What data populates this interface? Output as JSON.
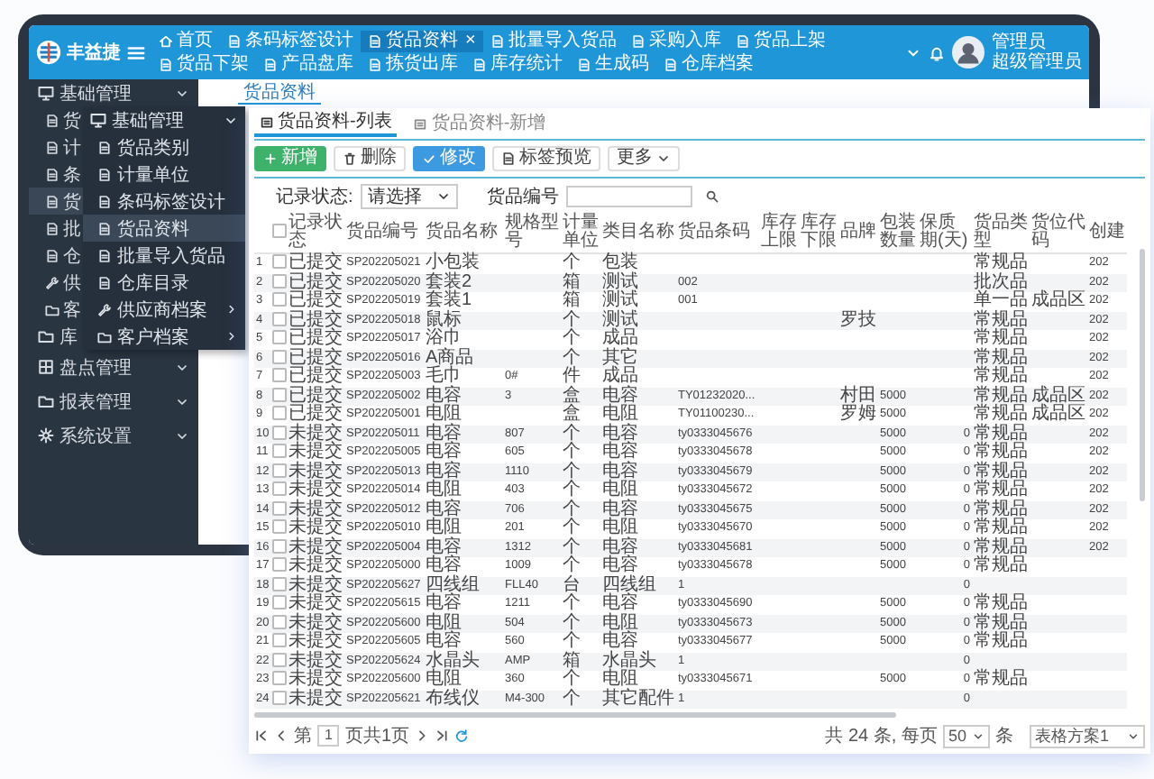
{
  "app": {
    "logo_text": "丰益捷",
    "user_name": "管理员",
    "user_role": "超级管理员"
  },
  "top_tabs": [
    {
      "label": "首页",
      "kind": "home",
      "selected": false
    },
    {
      "label": "条码标签设计",
      "kind": "page",
      "selected": false
    },
    {
      "label": "货品资料",
      "kind": "page",
      "selected": true,
      "close": "×"
    },
    {
      "label": "批量导入货品",
      "kind": "page",
      "selected": false
    },
    {
      "label": "采购入库",
      "kind": "page",
      "selected": false
    },
    {
      "label": "货品上架",
      "kind": "page",
      "selected": false
    },
    {
      "label": "货品下架",
      "kind": "page",
      "selected": false
    },
    {
      "label": "产品盘库",
      "kind": "page",
      "selected": false
    },
    {
      "label": "拣货出库",
      "kind": "page",
      "selected": false
    },
    {
      "label": "库存统计",
      "kind": "page",
      "selected": false
    },
    {
      "label": "生成码",
      "kind": "page",
      "selected": false
    },
    {
      "label": "仓库档案",
      "kind": "page",
      "selected": false
    }
  ],
  "sidebar": {
    "items": [
      {
        "label": "基础管理",
        "kind": "monitor",
        "expandable": true,
        "children": [
          {
            "label": "货",
            "kind": "page",
            "selected": false
          },
          {
            "label": "计",
            "kind": "page",
            "selected": false
          },
          {
            "label": "条",
            "kind": "page",
            "selected": false
          },
          {
            "label": "货",
            "kind": "page",
            "selected": true
          },
          {
            "label": "批",
            "kind": "page",
            "selected": false
          },
          {
            "label": "仓",
            "kind": "page",
            "selected": false
          },
          {
            "label": "供",
            "kind": "tool",
            "selected": false
          },
          {
            "label": "客",
            "kind": "folder",
            "selected": false
          }
        ]
      },
      {
        "label": "库",
        "kind": "folder"
      },
      {
        "label": "盘点管理",
        "kind": "grid",
        "expandable": true
      },
      {
        "label": "报表管理",
        "kind": "folder",
        "expandable": true
      },
      {
        "label": "系统设置",
        "kind": "gear",
        "expandable": true
      }
    ]
  },
  "flyout": {
    "title": "基础管理",
    "items": [
      {
        "label": "货品类别",
        "kind": "page",
        "selected": false,
        "submenu": false
      },
      {
        "label": "计量单位",
        "kind": "page",
        "selected": false,
        "submenu": false
      },
      {
        "label": "条码标签设计",
        "kind": "page",
        "selected": false,
        "submenu": false
      },
      {
        "label": "货品资料",
        "kind": "page",
        "selected": true,
        "submenu": false
      },
      {
        "label": "批量导入货品",
        "kind": "page",
        "selected": false,
        "submenu": false
      },
      {
        "label": "仓库目录",
        "kind": "page",
        "selected": false,
        "submenu": false
      },
      {
        "label": "供应商档案",
        "kind": "tool",
        "selected": false,
        "submenu": true
      },
      {
        "label": "客户档案",
        "kind": "folder",
        "selected": false,
        "submenu": true
      }
    ]
  },
  "breadcrumb": "货品资料",
  "panel_tabs": [
    {
      "label": "货品资料-列表",
      "selected": true
    },
    {
      "label": "货品资料-新增",
      "selected": false
    }
  ],
  "toolbar": [
    {
      "label": "新增",
      "kind": "add"
    },
    {
      "label": "删除",
      "kind": "delete"
    },
    {
      "label": "修改",
      "kind": "edit"
    },
    {
      "label": "标签预览",
      "kind": "preview"
    },
    {
      "label": "更多",
      "kind": "more"
    }
  ],
  "filters": {
    "status_label": "记录状态:",
    "status_value": "请选择",
    "code_label": "货品编号"
  },
  "table": {
    "select_all_checked": false,
    "columns": [
      "记录状态",
      "货品编号",
      "货品名称",
      "规格型号",
      "计量单位",
      "类目名称",
      "货品条码",
      "库存上限",
      "库存下限",
      "品牌",
      "包装数量",
      "保质期(天)",
      "货品类型",
      "货位代码",
      "创建"
    ],
    "rows": [
      {
        "no": "1",
        "checked": false,
        "st": "已提交",
        "code": "SP202205021",
        "name": "小包装",
        "unit": "个",
        "cat": "包装",
        "type": "常规品",
        "created": "202"
      },
      {
        "no": "2",
        "checked": false,
        "st": "已提交",
        "code": "SP202205020",
        "name": "套装2",
        "unit": "箱",
        "cat": "测试",
        "bar": "002",
        "type": "批次品",
        "created": "202"
      },
      {
        "no": "3",
        "checked": false,
        "st": "已提交",
        "code": "SP202205019",
        "name": "套装1",
        "unit": "箱",
        "cat": "测试",
        "bar": "001",
        "type": "单一品",
        "loc": "成品区",
        "created": "202"
      },
      {
        "no": "4",
        "checked": false,
        "st": "已提交",
        "code": "SP202205018",
        "name": "鼠标",
        "unit": "个",
        "cat": "测试",
        "brand": "罗技",
        "type": "常规品",
        "created": "202"
      },
      {
        "no": "5",
        "checked": false,
        "st": "已提交",
        "code": "SP202205017",
        "name": "浴巾",
        "unit": "个",
        "cat": "成品",
        "type": "常规品",
        "created": "202"
      },
      {
        "no": "6",
        "checked": false,
        "st": "已提交",
        "code": "SP202205016",
        "name": "A商品",
        "unit": "个",
        "cat": "其它",
        "type": "常规品",
        "created": "202"
      },
      {
        "no": "7",
        "checked": false,
        "st": "已提交",
        "code": "SP202205003",
        "name": "毛巾",
        "spec": "0#",
        "unit": "件",
        "cat": "成品",
        "type": "常规品",
        "created": "202"
      },
      {
        "no": "8",
        "checked": false,
        "st": "已提交",
        "code": "SP202205002",
        "name": "电容",
        "spec": "3",
        "unit": "盒",
        "cat": "电容",
        "bar": "TY01232020...",
        "brand": "村田",
        "pack": "5000",
        "type": "常规品",
        "loc": "成品区",
        "created": "202"
      },
      {
        "no": "9",
        "checked": false,
        "st": "已提交",
        "code": "SP202205001",
        "name": "电阻",
        "unit": "盒",
        "cat": "电阻",
        "bar": "TY01100230...",
        "brand": "罗姆",
        "pack": "5000",
        "type": "常规品",
        "loc": "成品区",
        "created": "202"
      },
      {
        "no": "10",
        "checked": false,
        "st": "未提交",
        "code": "SP202205011",
        "name": "电容",
        "spec": "807",
        "unit": "个",
        "cat": "电容",
        "bar": "ty0333045676",
        "pack": "5000",
        "shelf": "0",
        "type": "常规品",
        "created": "202"
      },
      {
        "no": "11",
        "checked": false,
        "st": "未提交",
        "code": "SP202205005",
        "name": "电容",
        "spec": "605",
        "unit": "个",
        "cat": "电容",
        "bar": "ty0333045678",
        "pack": "5000",
        "shelf": "0",
        "type": "常规品",
        "created": "202"
      },
      {
        "no": "12",
        "checked": false,
        "st": "未提交",
        "code": "SP202205013",
        "name": "电容",
        "spec": "1110",
        "unit": "个",
        "cat": "电容",
        "bar": "ty0333045679",
        "pack": "5000",
        "shelf": "0",
        "type": "常规品",
        "created": "202"
      },
      {
        "no": "13",
        "checked": false,
        "st": "未提交",
        "code": "SP202205014",
        "name": "电阻",
        "spec": "403",
        "unit": "个",
        "cat": "电阻",
        "bar": "ty0333045672",
        "pack": "5000",
        "shelf": "0",
        "type": "常规品",
        "created": "202"
      },
      {
        "no": "14",
        "checked": false,
        "st": "未提交",
        "code": "SP202205012",
        "name": "电容",
        "spec": "706",
        "unit": "个",
        "cat": "电容",
        "bar": "ty0333045675",
        "pack": "5000",
        "shelf": "0",
        "type": "常规品",
        "created": "202"
      },
      {
        "no": "15",
        "checked": false,
        "st": "未提交",
        "code": "SP202205010",
        "name": "电阻",
        "spec": "201",
        "unit": "个",
        "cat": "电阻",
        "bar": "ty0333045670",
        "pack": "5000",
        "shelf": "0",
        "type": "常规品",
        "created": "202"
      },
      {
        "no": "16",
        "checked": false,
        "st": "未提交",
        "code": "SP202205004",
        "name": "电容",
        "spec": "1312",
        "unit": "个",
        "cat": "电容",
        "bar": "ty0333045681",
        "pack": "5000",
        "shelf": "0",
        "type": "常规品",
        "created": "202"
      },
      {
        "no": "17",
        "checked": false,
        "st": "未提交",
        "code": "SP202205000",
        "name": "电容",
        "spec": "1009",
        "unit": "个",
        "cat": "电容",
        "bar": "ty0333045678",
        "pack": "5000",
        "shelf": "0",
        "type": "常规品"
      },
      {
        "no": "18",
        "checked": false,
        "st": "未提交",
        "code": "SP202205627",
        "name": "四线组",
        "spec": "FLL40",
        "unit": "台",
        "cat": "四线组",
        "bar": "1",
        "shelf": "0"
      },
      {
        "no": "19",
        "checked": false,
        "st": "未提交",
        "code": "SP202205615",
        "name": "电容",
        "spec": "1211",
        "unit": "个",
        "cat": "电容",
        "bar": "ty0333045690",
        "pack": "5000",
        "shelf": "0",
        "type": "常规品"
      },
      {
        "no": "20",
        "checked": false,
        "st": "未提交",
        "code": "SP202205600",
        "name": "电阻",
        "spec": "504",
        "unit": "个",
        "cat": "电阻",
        "bar": "ty0333045673",
        "pack": "5000",
        "shelf": "0",
        "type": "常规品"
      },
      {
        "no": "21",
        "checked": false,
        "st": "未提交",
        "code": "SP202205605",
        "name": "电容",
        "spec": "560",
        "unit": "个",
        "cat": "电容",
        "bar": "ty0333045677",
        "pack": "5000",
        "shelf": "0",
        "type": "常规品"
      },
      {
        "no": "22",
        "checked": false,
        "st": "未提交",
        "code": "SP202205624",
        "name": "水晶头",
        "spec": "AMP",
        "unit": "箱",
        "cat": "水晶头",
        "bar": "1",
        "shelf": "0"
      },
      {
        "no": "23",
        "checked": false,
        "st": "未提交",
        "code": "SP202205600",
        "name": "电阻",
        "spec": "360",
        "unit": "个",
        "cat": "电阻",
        "bar": "ty0333045671",
        "pack": "5000",
        "shelf": "0",
        "type": "常规品"
      },
      {
        "no": "24",
        "checked": false,
        "st": "未提交",
        "code": "SP202205621",
        "name": "布线仪",
        "spec": "M4-300",
        "unit": "个",
        "cat": "其它配件",
        "bar": "1",
        "shelf": "0"
      }
    ]
  },
  "pagination": {
    "before": "第",
    "page": "1",
    "after": "页共1页",
    "total": "共 24 条, 每页",
    "page_size": "50",
    "unit": "条",
    "scheme": "表格方案1"
  }
}
